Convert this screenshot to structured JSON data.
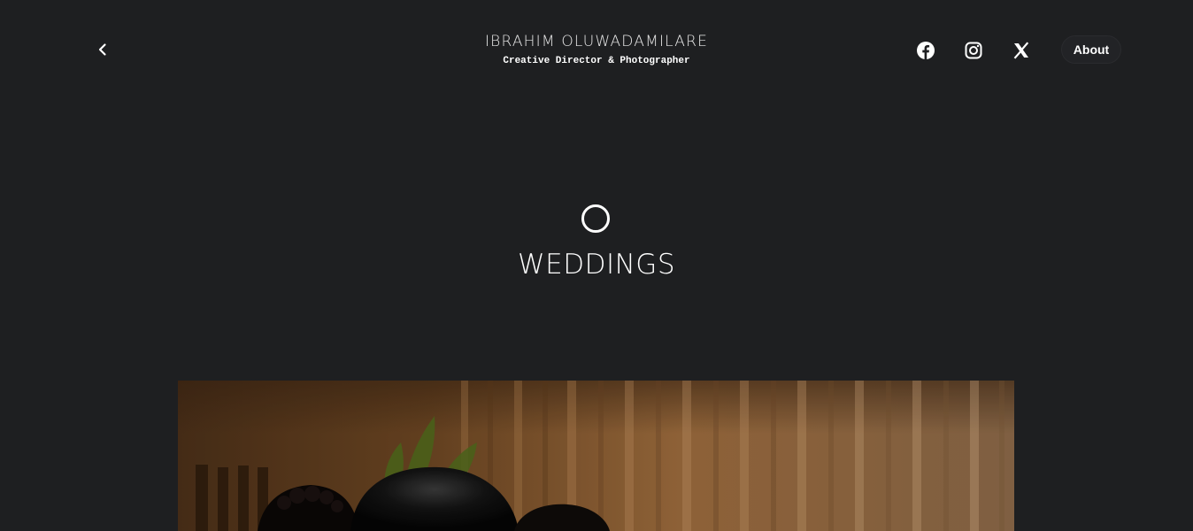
{
  "header": {
    "title": "IBRAHIM OLUWADAMILARE",
    "subtitle": "Creative Director & Photographer",
    "about_label": "About",
    "social": [
      "facebook-icon",
      "instagram-icon",
      "x-icon"
    ]
  },
  "hero": {
    "title": "WEDDINGS"
  },
  "colors": {
    "background": "#1e1f21",
    "text": "#ffffff"
  }
}
